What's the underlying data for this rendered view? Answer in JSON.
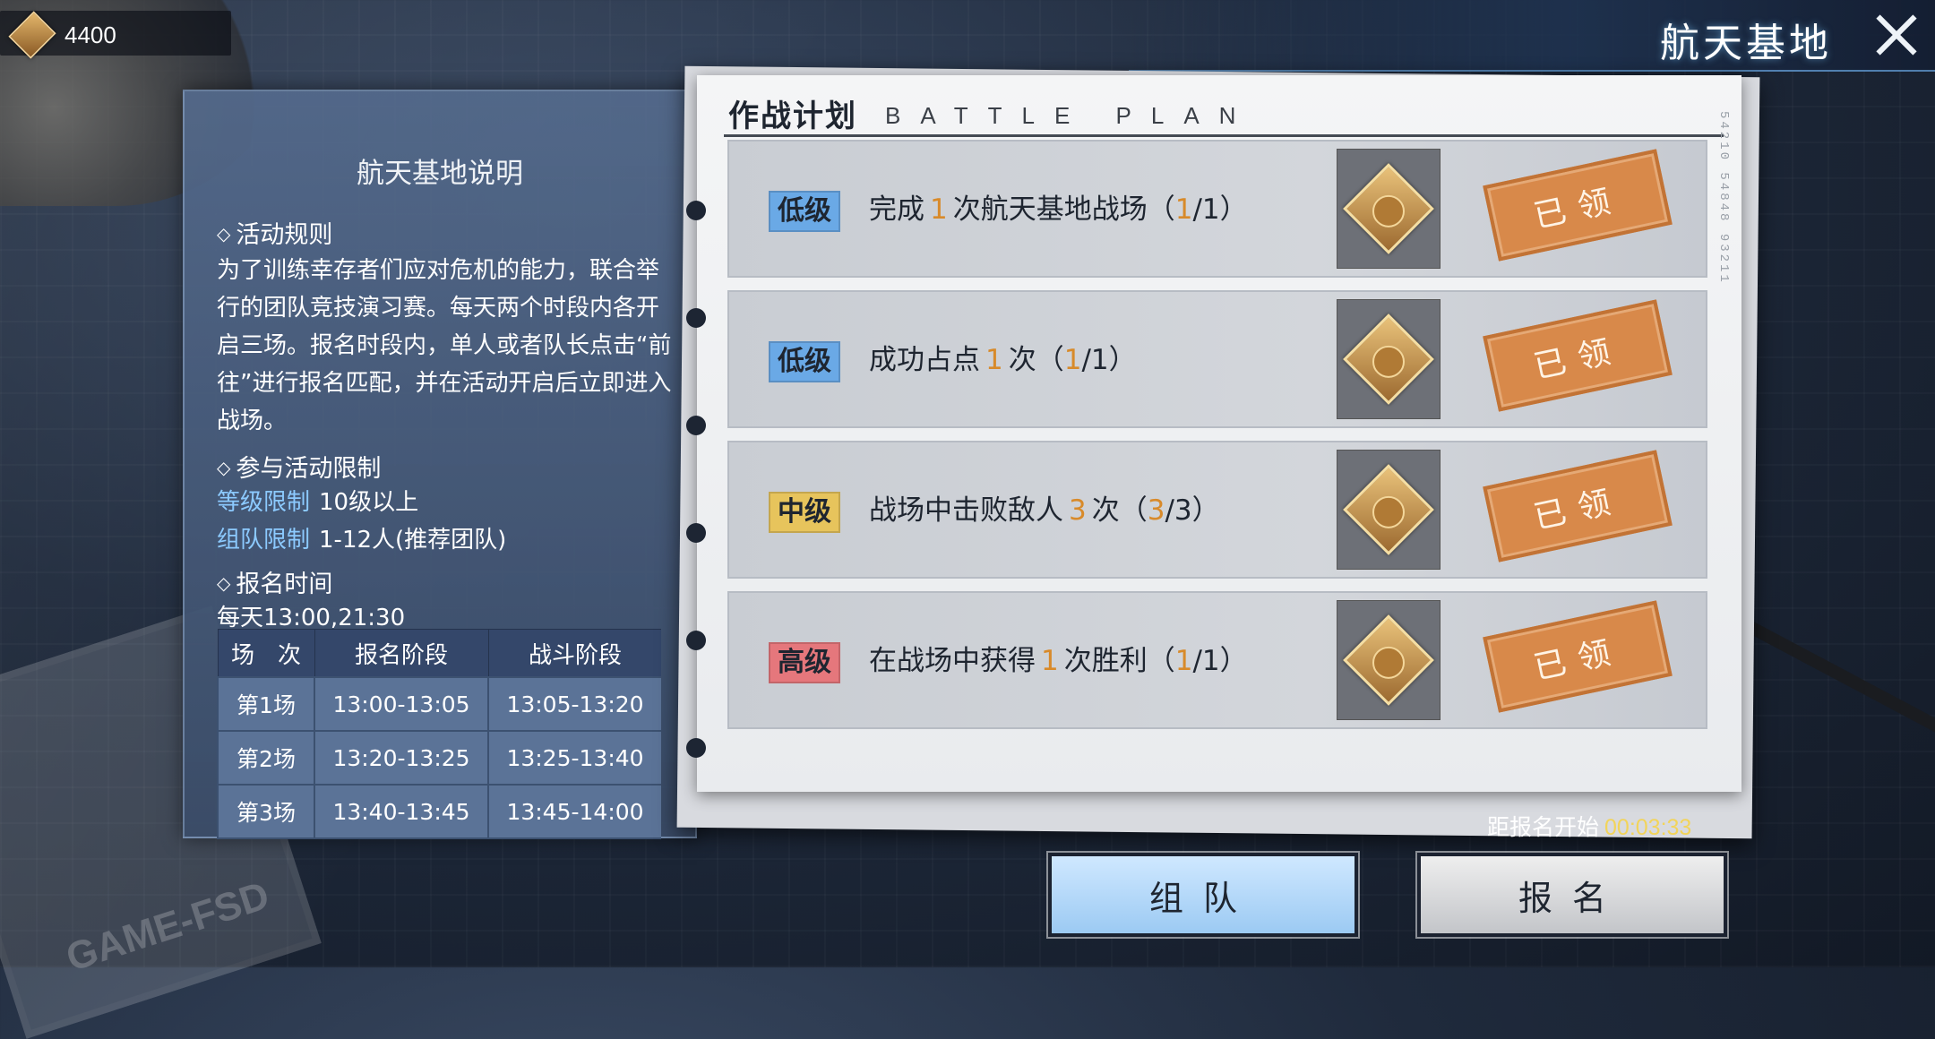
{
  "currency": {
    "amount": "4400",
    "icon": "medal-icon"
  },
  "header": {
    "title": "航天基地"
  },
  "info": {
    "title": "航天基地说明",
    "rules_heading": "活动规则",
    "rules_text": "为了训练幸存者们应对危机的能力，联合举行的团队竞技演习赛。每天两个时段内各开启三场。报名时段内，单人或者队长点击“前往”进行报名匹配，并在活动开启后立即进入战场。",
    "limits_heading": "参与活动限制",
    "level_label": "等级限制",
    "level_value": "10级以上",
    "team_label": "组队限制",
    "team_value": "1-12人(推荐团队)",
    "signup_heading": "报名时间",
    "signup_time": "每天13:00,21:30",
    "table": {
      "headers": [
        "场　次",
        "报名阶段",
        "战斗阶段"
      ],
      "rows": [
        [
          "第1场",
          "13:00-13:05",
          "13:05-13:20"
        ],
        [
          "第2场",
          "13:20-13:25",
          "13:25-13:40"
        ],
        [
          "第3场",
          "13:40-13:45",
          "13:45-14:00"
        ]
      ]
    }
  },
  "plan": {
    "title": "作战计划",
    "subtitle": "BATTLE PLAN",
    "code": "54210 54848 93211",
    "tasks": [
      {
        "badge": "低级",
        "level": "low",
        "pre": "完成",
        "num": "1",
        "post": "次航天基地战场（",
        "prog_num": "1",
        "prog_tail": "/1）",
        "status": "已领"
      },
      {
        "badge": "低级",
        "level": "low",
        "pre": "成功占点",
        "num": "1",
        "post": "次（",
        "prog_num": "1",
        "prog_tail": "/1）",
        "status": "已领"
      },
      {
        "badge": "中级",
        "level": "mid",
        "pre": "战场中击败敌人",
        "num": "3",
        "post": "次（",
        "prog_num": "3",
        "prog_tail": "/3）",
        "status": "已领"
      },
      {
        "badge": "高级",
        "level": "high",
        "pre": "在战场中获得",
        "num": "1",
        "post": "次胜利（",
        "prog_num": "1",
        "prog_tail": "/1）",
        "status": "已领"
      }
    ]
  },
  "countdown": {
    "label": "距报名开始",
    "time": "00:03:33"
  },
  "buttons": {
    "team": "组队",
    "signup": "报名"
  },
  "colors": {
    "badge_low": "#6aa9e6",
    "badge_mid": "#e7c45c",
    "badge_high": "#e5777c",
    "stamp": "#d8894a",
    "accent_num": "#d88a2a",
    "timer": "#f2d45a"
  }
}
